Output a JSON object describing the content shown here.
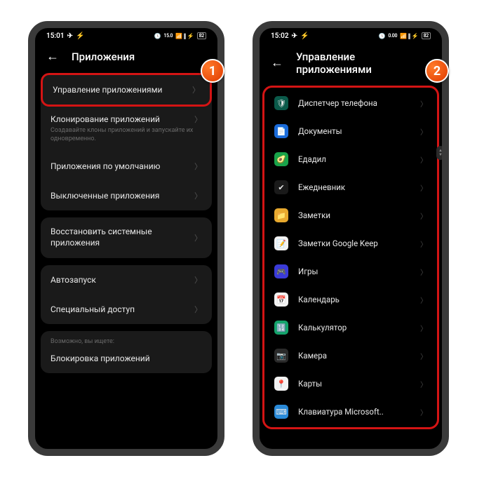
{
  "badges": {
    "one": "1",
    "two": "2"
  },
  "screen1": {
    "status": {
      "time": "15:01",
      "indicators": "✈ ⚡ 15.0 KB/s 📶 ⚡82%"
    },
    "header": {
      "title": "Приложения"
    },
    "rows": {
      "manage": "Управление приложениями",
      "clone": "Клонирование приложений",
      "clone_sub": "Создавайте клоны приложений и запускайте их одновременно.",
      "default": "Приложения по умолчанию",
      "disabled": "Выключенные приложения",
      "restore": "Восстановить системные приложения",
      "autostart": "Автозапуск",
      "special": "Специальный доступ"
    },
    "suggest": {
      "label": "Возможно, вы ищете:",
      "item": "Блокировка приложений"
    }
  },
  "screen2": {
    "status": {
      "time": "15:02",
      "indicators": "✈ ⚡ 0.00 KB/s 📶 ⚡82%"
    },
    "header": {
      "title": "Управление приложениями"
    },
    "apps": [
      {
        "name": "Диспетчер телефона",
        "color": "#0b5a4a",
        "glyph": "🛡"
      },
      {
        "name": "Документы",
        "color": "#1a6ad8",
        "glyph": "📄"
      },
      {
        "name": "Едадил",
        "color": "#19a34a",
        "glyph": "🥑"
      },
      {
        "name": "Ежедневник",
        "color": "#1a1a1a",
        "glyph": "✔"
      },
      {
        "name": "Заметки",
        "color": "#e8a92e",
        "glyph": "📁"
      },
      {
        "name": "Заметки Google Keep",
        "color": "#f2f2f2",
        "glyph": "📝"
      },
      {
        "name": "Игры",
        "color": "#3b3bd8",
        "glyph": "🎮"
      },
      {
        "name": "Календарь",
        "color": "#f2f2f2",
        "glyph": "📅"
      },
      {
        "name": "Калькулятор",
        "color": "#14a36b",
        "glyph": "🔢"
      },
      {
        "name": "Камера",
        "color": "#2a2a2a",
        "glyph": "📷"
      },
      {
        "name": "Карты",
        "color": "#f2f2f2",
        "glyph": "📍"
      },
      {
        "name": "Клавиатура Microsoft..",
        "color": "#2a8ad8",
        "glyph": "⌨"
      }
    ]
  }
}
